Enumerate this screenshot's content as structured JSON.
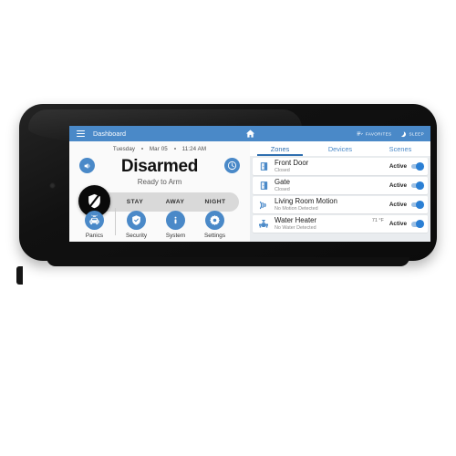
{
  "device": {
    "type": "wall-mounted security touchscreen tablet"
  },
  "appbar": {
    "menu_icon": "hamburger-icon",
    "title": "Dashboard",
    "home_icon": "home-icon",
    "favorites": {
      "label": "FAVORITES",
      "icon": "favorites-list-icon"
    },
    "sleep": {
      "label": "SLEEP",
      "icon": "moon-icon"
    },
    "bg_color": "#4a89c8"
  },
  "left_panel": {
    "datetime": {
      "day": "Tuesday",
      "date": "Mar 05",
      "time": "11:24 AM"
    },
    "speaker_icon": "speaker-icon",
    "clock_icon": "clock-icon",
    "status": "Disarmed",
    "ready": "Ready to Arm",
    "disarm_icon": "shield-slash-icon",
    "arm_options": [
      {
        "label": "STAY"
      },
      {
        "label": "AWAY"
      },
      {
        "label": "NIGHT"
      }
    ],
    "nav": [
      {
        "label": "Panics",
        "icon": "police-car-icon"
      },
      {
        "label": "Security",
        "icon": "shield-check-icon"
      },
      {
        "label": "System",
        "icon": "info-icon"
      },
      {
        "label": "Settings",
        "icon": "gear-icon"
      }
    ]
  },
  "right_panel": {
    "tabs": [
      {
        "label": "Zones",
        "active": true
      },
      {
        "label": "Devices",
        "active": false
      },
      {
        "label": "Scenes",
        "active": false
      }
    ],
    "zones": [
      {
        "name": "Front Door",
        "status": "Closed",
        "icon": "door-icon",
        "state": "Active",
        "toggle_on": true,
        "temp": ""
      },
      {
        "name": "Gate",
        "status": "Closed",
        "icon": "door-icon",
        "state": "Active",
        "toggle_on": true,
        "temp": ""
      },
      {
        "name": "Living Room Motion",
        "status": "No Motion Detected",
        "icon": "motion-sensor-icon",
        "state": "Active",
        "toggle_on": true,
        "temp": ""
      },
      {
        "name": "Water Heater",
        "status": "No Water Detected",
        "icon": "water-valve-icon",
        "state": "Active",
        "toggle_on": true,
        "temp": "71 °F"
      }
    ]
  },
  "colors": {
    "accent_blue": "#4a89c8",
    "toggle_blue": "#2b7fd4",
    "panel_bg": "#e9ecef",
    "left_bg": "#fafafa",
    "bezel": "#141414"
  }
}
